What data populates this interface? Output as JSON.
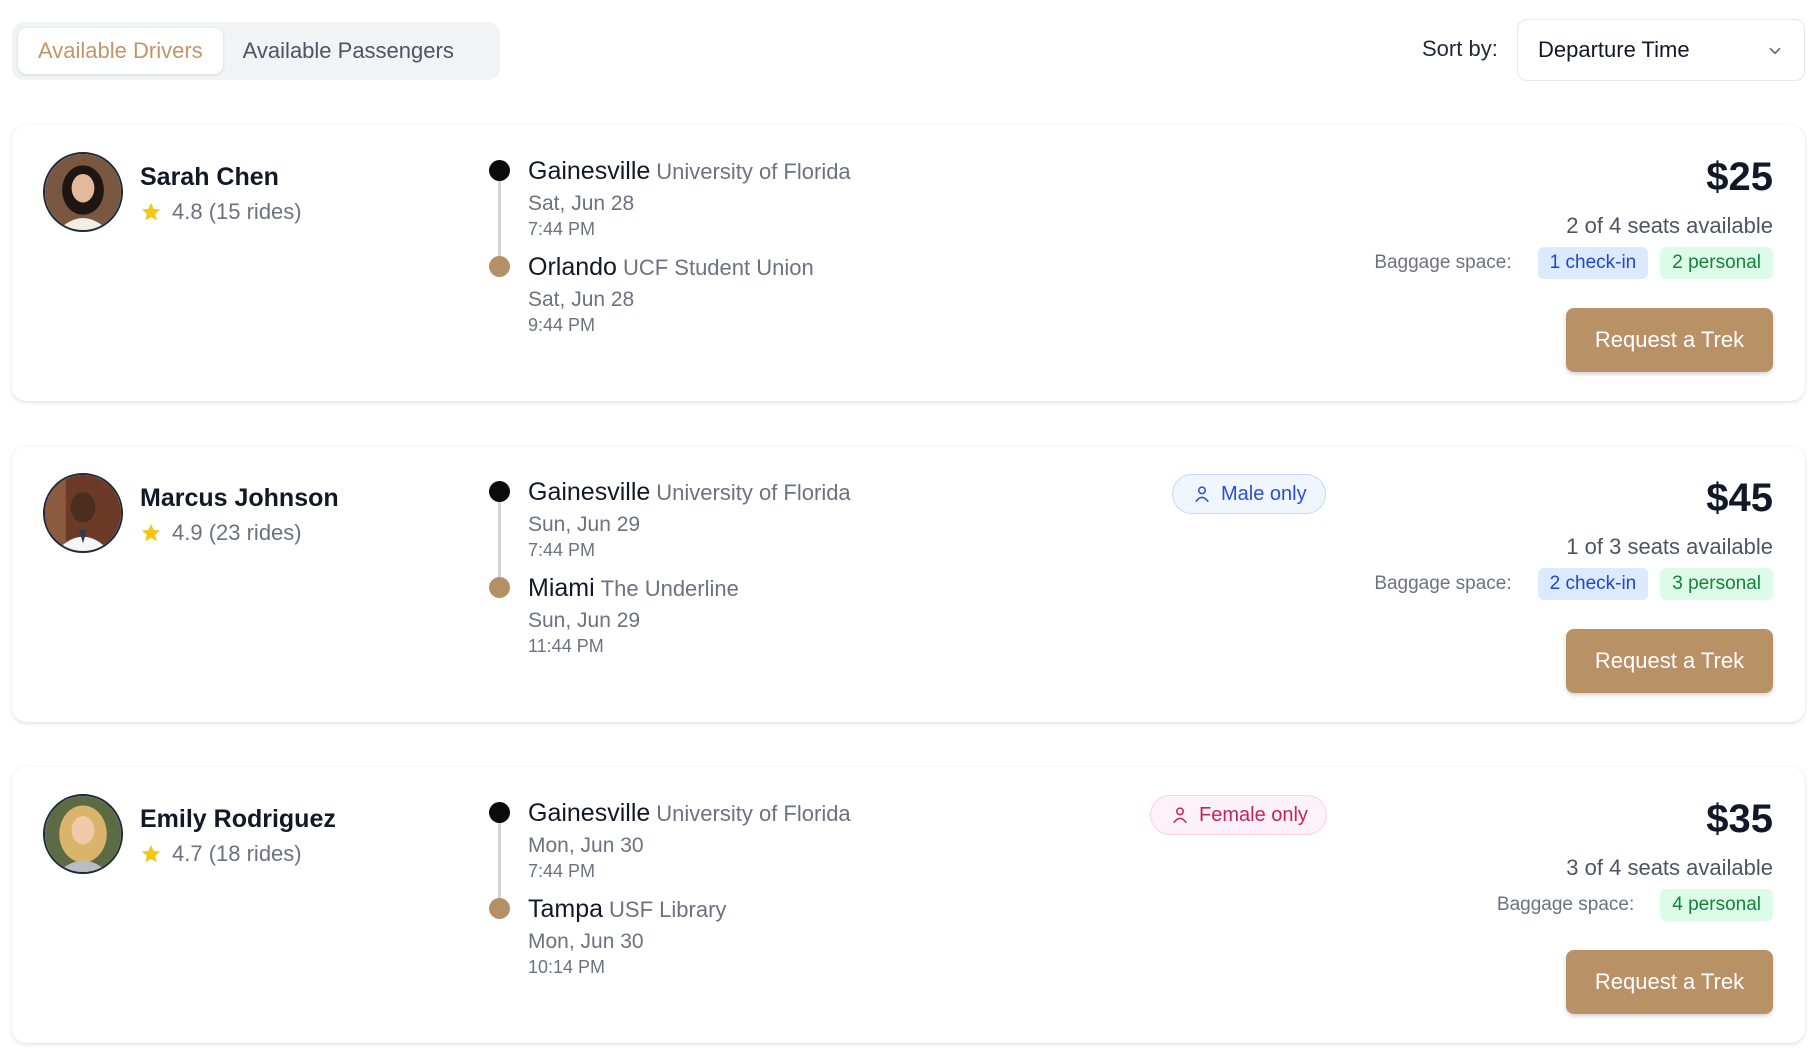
{
  "tabs": [
    {
      "label": "Available Drivers",
      "active": true
    },
    {
      "label": "Available Passengers",
      "active": false
    }
  ],
  "sort": {
    "label": "Sort by:",
    "value": "Departure Time"
  },
  "colors": {
    "accent": "#b89167",
    "active_tab_text": "#c09669",
    "star": "#f5c518",
    "origin_dot": "#0b0b0b",
    "destination_dot": "#b58f66"
  },
  "drivers": [
    {
      "name": "Sarah Chen",
      "rating": "4.8 (15 rides)",
      "from": {
        "city": "Gainesville",
        "place": "University of Florida",
        "date": "Sat, Jun 28",
        "time": "7:44 PM"
      },
      "to": {
        "city": "Orlando",
        "place": "UCF Student Union",
        "date": "Sat, Jun 28",
        "time": "9:44 PM"
      },
      "preference": null,
      "price": "$25",
      "seats": "2 of 4 seats available",
      "baggage_label": "Baggage space:",
      "baggage": {
        "checkin": "1 check-in",
        "personal": "2 personal"
      },
      "button": "Request a Trek"
    },
    {
      "name": "Marcus Johnson",
      "rating": "4.9 (23 rides)",
      "from": {
        "city": "Gainesville",
        "place": "University of Florida",
        "date": "Sun, Jun 29",
        "time": "7:44 PM"
      },
      "to": {
        "city": "Miami",
        "place": "The Underline",
        "date": "Sun, Jun 29",
        "time": "11:44 PM"
      },
      "preference": "Male only",
      "price": "$45",
      "seats": "1 of 3 seats available",
      "baggage_label": "Baggage space:",
      "baggage": {
        "checkin": "2 check-in",
        "personal": "3 personal"
      },
      "button": "Request a Trek"
    },
    {
      "name": "Emily Rodriguez",
      "rating": "4.7 (18 rides)",
      "from": {
        "city": "Gainesville",
        "place": "University of Florida",
        "date": "Mon, Jun 30",
        "time": "7:44 PM"
      },
      "to": {
        "city": "Tampa",
        "place": "USF Library",
        "date": "Mon, Jun 30",
        "time": "10:14 PM"
      },
      "preference": "Female only",
      "price": "$35",
      "seats": "3 of 4 seats available",
      "baggage_label": "Baggage space:",
      "baggage": {
        "checkin": null,
        "personal": "4 personal"
      },
      "button": "Request a Trek"
    }
  ]
}
